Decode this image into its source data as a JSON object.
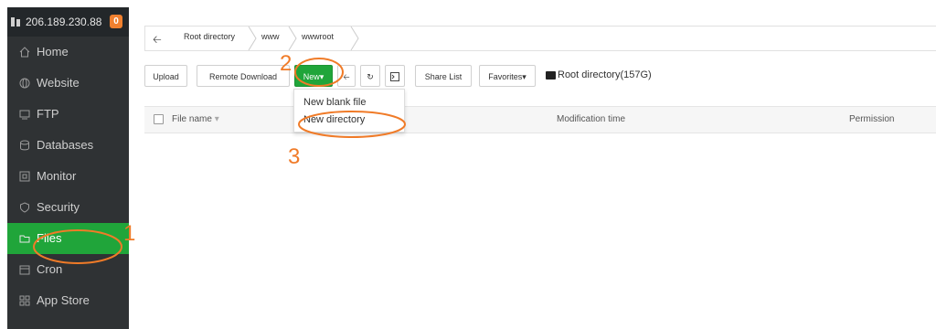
{
  "server": {
    "ip": "206.189.230.88",
    "badge": "0"
  },
  "sidebar": {
    "items": [
      {
        "label": "Home",
        "icon": "home-icon"
      },
      {
        "label": "Website",
        "icon": "globe-icon"
      },
      {
        "label": "FTP",
        "icon": "ftp-icon"
      },
      {
        "label": "Databases",
        "icon": "database-icon"
      },
      {
        "label": "Monitor",
        "icon": "monitor-icon"
      },
      {
        "label": "Security",
        "icon": "shield-icon"
      },
      {
        "label": "Files",
        "icon": "folder-icon",
        "active": true
      },
      {
        "label": "Cron",
        "icon": "calendar-icon"
      },
      {
        "label": "App Store",
        "icon": "grid-icon"
      }
    ]
  },
  "breadcrumb": {
    "items": [
      "Root directory",
      "www",
      "wwwroot"
    ]
  },
  "toolbar": {
    "upload": "Upload",
    "remote_download": "Remote Download",
    "new": "New",
    "share_list": "Share List",
    "favorites": "Favorites",
    "disk": "Root directory(157G)"
  },
  "table": {
    "headers": [
      "File name",
      "Modification time",
      "Permission"
    ]
  },
  "dropdown": {
    "items": [
      "New blank file",
      "New directory"
    ]
  },
  "annotations": {
    "one": "1",
    "two": "2",
    "three": "3"
  },
  "colors": {
    "accent": "#20a53a",
    "annotation": "#f07b28",
    "sidebar_bg": "#2f3234",
    "badge": "#f0802f"
  }
}
